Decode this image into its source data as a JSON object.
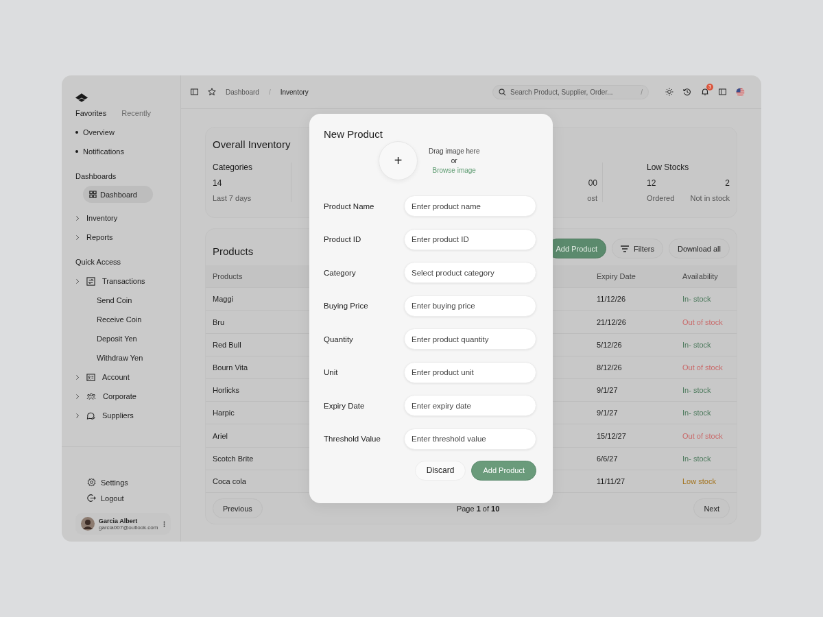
{
  "sidebar": {
    "tabs": [
      {
        "label": "Favorites",
        "selected": true
      },
      {
        "label": "Recently",
        "selected": false
      }
    ],
    "favorites": [
      "Overview",
      "Notifications"
    ],
    "dashboards_heading": "Dashboards",
    "dashboards": [
      {
        "label": "Dashboard",
        "kind": "grid",
        "selected": true
      },
      {
        "label": "Inventory",
        "kind": "expandable",
        "selected": false
      },
      {
        "label": "Reports",
        "kind": "expandable",
        "selected": false
      }
    ],
    "quick_heading": "Quick Access",
    "quick": [
      {
        "label": "Transactions",
        "kind": "transactions",
        "children": [
          {
            "label": "Send Coin"
          },
          {
            "label": "Receive Coin"
          },
          {
            "label": "Deposit Yen"
          },
          {
            "label": "Withdraw Yen"
          }
        ]
      },
      {
        "label": "Account",
        "kind": "account"
      },
      {
        "label": "Corporate",
        "kind": "corporate"
      },
      {
        "label": "Suppliers",
        "kind": "suppliers"
      }
    ],
    "footer": [
      {
        "label": "Settings",
        "kind": "settings"
      },
      {
        "label": "Logout",
        "kind": "logout"
      }
    ],
    "user": {
      "name": "Garcia Albert",
      "email": "garcia007@outlook.com"
    }
  },
  "topbar": {
    "breadcrumb": [
      {
        "label": "Dashboard",
        "selected": false
      },
      {
        "label": "Inventory",
        "selected": true
      }
    ],
    "separator": "/",
    "search": {
      "placeholder": "Search Product, Supplier, Order...",
      "shortcut": "/"
    },
    "notifications": "3"
  },
  "inventory": {
    "title": "Overall Inventory",
    "stats": [
      {
        "heading": "Categories",
        "values": [
          "14"
        ],
        "labels": [
          "Last 7 days"
        ]
      },
      {
        "values": [
          "00"
        ],
        "labels": [
          "ost"
        ]
      },
      {
        "heading": "Low Stocks",
        "values": [
          "12",
          "2"
        ],
        "labels": [
          "Ordered",
          "Not in stock"
        ]
      }
    ]
  },
  "products": {
    "title": "Products",
    "actions": [
      {
        "label": "Add Product",
        "kind": "primary"
      },
      {
        "label": "Filters",
        "kind": "filter"
      },
      {
        "label": "Download all",
        "kind": "plain"
      }
    ],
    "columns": [
      "Products",
      "Expiry Date",
      "Availability"
    ],
    "rows": [
      {
        "name": "Maggi",
        "expiry": "11/12/26",
        "availability": "In- stock",
        "color": "#4d7a5d"
      },
      {
        "name": "Bru",
        "expiry": "21/12/26",
        "availability": "Out of stock",
        "color": "#c96a6a"
      },
      {
        "name": "Red Bull",
        "expiry": "5/12/26",
        "availability": "In- stock",
        "color": "#4d7a5d"
      },
      {
        "name": "Bourn Vita",
        "expiry": "8/12/26",
        "availability": "Out of stock",
        "color": "#c96a6a"
      },
      {
        "name": "Horlicks",
        "expiry": "9/1/27",
        "availability": "In- stock",
        "color": "#4d7a5d"
      },
      {
        "name": "Harpic",
        "expiry": "9/1/27",
        "availability": "In- stock",
        "color": "#4d7a5d"
      },
      {
        "name": "Ariel",
        "expiry": "15/12/27",
        "availability": "Out of stock",
        "color": "#c96a6a"
      },
      {
        "name": "Scotch Brite",
        "expiry": "6/6/27",
        "availability": "In- stock",
        "color": "#4d7a5d"
      },
      {
        "name": "Coca cola",
        "expiry": "11/11/27",
        "availability": "Low  stock",
        "color": "#a3731c"
      }
    ],
    "pagination": {
      "previous": "Previous",
      "page": "Page **1** of **10**",
      "next": "Next"
    }
  },
  "modal": {
    "title": "New Product",
    "upload": {
      "plus": "+",
      "hint": "Drag image here",
      "or": "or",
      "link": "Browse image"
    },
    "fields": [
      {
        "label": "Product Name",
        "placeholder": "Enter product name"
      },
      {
        "label": "Product ID",
        "placeholder": "Enter product ID"
      },
      {
        "label": "Category",
        "placeholder": "Select product category"
      },
      {
        "label": "Buying Price",
        "placeholder": "Enter buying price"
      },
      {
        "label": "Quantity",
        "placeholder": "Enter product quantity"
      },
      {
        "label": "Unit",
        "placeholder": "Enter product unit"
      },
      {
        "label": "Expiry Date",
        "placeholder": "Enter expiry date"
      },
      {
        "label": "Threshold Value",
        "placeholder": "Enter threshold value"
      }
    ],
    "buttons": [
      {
        "label": "Discard",
        "kind": "secondary"
      },
      {
        "label": "Add Product",
        "kind": "primary"
      }
    ]
  }
}
